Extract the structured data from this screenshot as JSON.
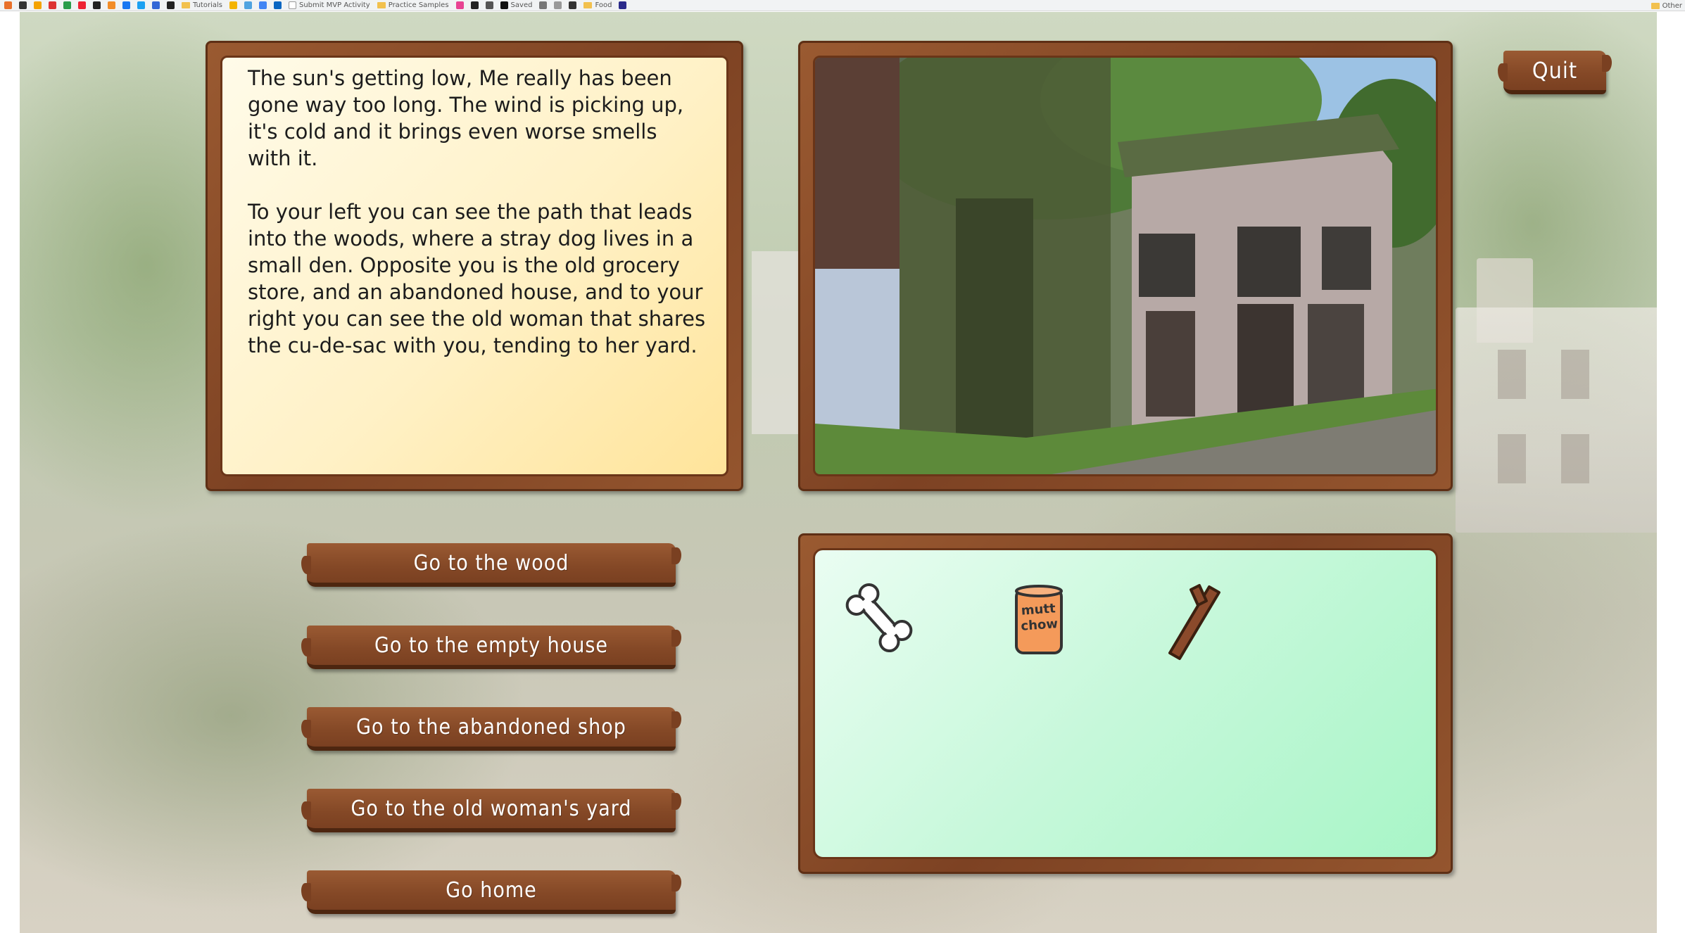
{
  "browser": {
    "bookmarks": [
      "Tutorials",
      "Submit MVP Activity",
      "Practice Samples",
      "Saved",
      "Food"
    ],
    "other_bookmarks": "Other"
  },
  "game": {
    "quit_label": "Quit",
    "story_text": "The sun's getting low, Me really has been gone way too long. The wind is picking up, it's cold and it brings even worse smells with it.\n\nTo your left you can see the path that leads into the woods, where a stray dog lives in a small den. Opposite you is the old grocery store, and an abandoned house, and to your right you can see the old woman that shares the cu-de-sac with you, tending to her yard.",
    "choices": [
      "Go to the wood",
      "Go to the empty house",
      "Go to the abandoned shop",
      "Go to the old woman's yard",
      "Go home"
    ],
    "inventory": {
      "items": [
        "bone",
        "mutt-chow-can",
        "stick"
      ],
      "can_label": "mutt chow"
    }
  },
  "colors": {
    "wood": "#844826",
    "story_bg": "#fff1c6",
    "inventory_bg": "#c6f8da",
    "can_orange": "#f49a5a"
  }
}
